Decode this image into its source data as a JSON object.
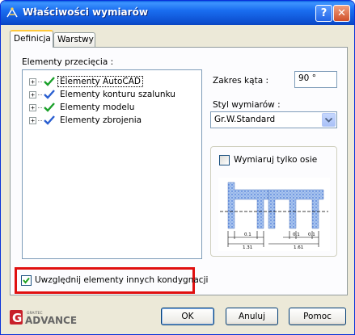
{
  "window": {
    "title": "Właściwości wymiarów",
    "help_button": "?",
    "close_button": "✕"
  },
  "tabs": [
    {
      "label": "Definicja",
      "active": true
    },
    {
      "label": "Warstwy",
      "active": false
    }
  ],
  "sections": {
    "elements_label": "Elementy przecięcia :",
    "angle_label": "Zakres kąta :",
    "angle_value": "90 °",
    "style_label": "Styl wymiarów :",
    "style_value": "Gr.W.Standard",
    "axes_only_label": "Wymiaruj tylko osie",
    "axes_only_checked": false,
    "other_storeys_label": "Uwzględnij elementy innych kondygnacji",
    "other_storeys_checked": true
  },
  "tree": [
    {
      "label": "Elementy AutoCAD",
      "checked": true,
      "check_color": "#1aa02a",
      "selected": true
    },
    {
      "label": "Elementy konturu szalunku",
      "checked": true,
      "check_color": "#2a5fd0",
      "selected": false
    },
    {
      "label": "Elementy modelu",
      "checked": true,
      "check_color": "#1aa02a",
      "selected": false
    },
    {
      "label": "Elementy zbrojenia",
      "checked": true,
      "check_color": "#2a5fd0",
      "selected": false
    }
  ],
  "preview_dims": {
    "left_small": "0.1",
    "left_total": "1.31",
    "right_small_a": "0.1",
    "right_small_b": "0.1",
    "right_total": "1.61"
  },
  "buttons": {
    "ok": "OK",
    "cancel": "Anuluj",
    "help": "Pomoc"
  },
  "logo": {
    "text": "ADVANCE",
    "prefix": "G",
    "small": "GRAITEC"
  },
  "colors": {
    "title_bar": "#0a5fe0",
    "highlight": "#e01010",
    "check_green": "#1aa02a",
    "check_blue": "#2a5fd0"
  }
}
